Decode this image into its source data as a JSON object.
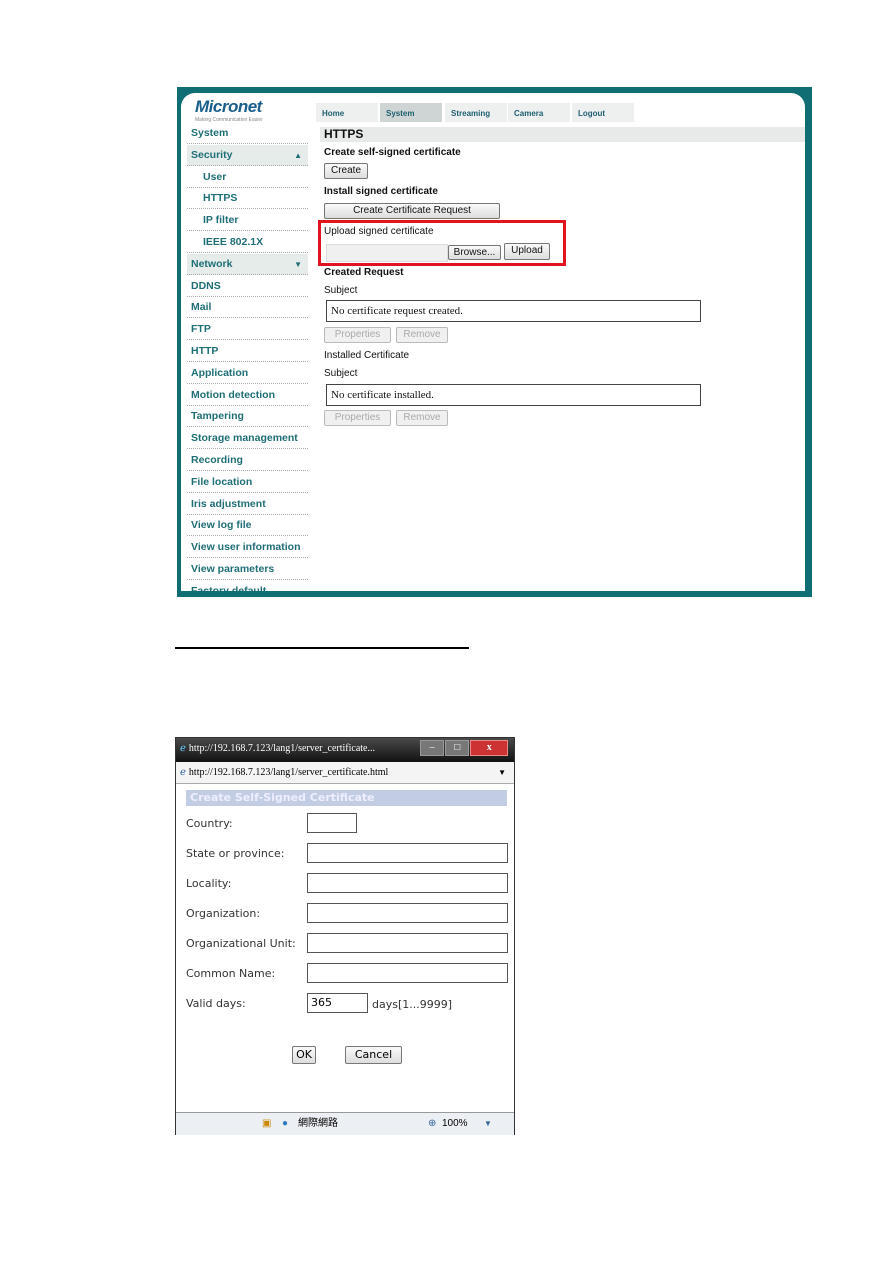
{
  "app": {
    "logo": "Micronet",
    "logo_tagline": "Making Communication Easier",
    "tabs": [
      "Home",
      "System",
      "Streaming",
      "Camera",
      "Logout"
    ],
    "active_tab": "System",
    "sidebar": [
      {
        "label": "System",
        "type": "item"
      },
      {
        "label": "Security",
        "type": "group",
        "arrow": "▲"
      },
      {
        "label": "User",
        "type": "sub"
      },
      {
        "label": "HTTPS",
        "type": "sub"
      },
      {
        "label": "IP filter",
        "type": "sub"
      },
      {
        "label": "IEEE 802.1X",
        "type": "sub"
      },
      {
        "label": "Network",
        "type": "group",
        "arrow": "▼"
      },
      {
        "label": "DDNS",
        "type": "item"
      },
      {
        "label": "Mail",
        "type": "item"
      },
      {
        "label": "FTP",
        "type": "item"
      },
      {
        "label": "HTTP",
        "type": "item"
      },
      {
        "label": "Application",
        "type": "item"
      },
      {
        "label": "Motion detection",
        "type": "item"
      },
      {
        "label": "Tampering",
        "type": "item"
      },
      {
        "label": "Storage management",
        "type": "item"
      },
      {
        "label": "Recording",
        "type": "item"
      },
      {
        "label": "File location",
        "type": "item"
      },
      {
        "label": "Iris adjustment",
        "type": "item"
      },
      {
        "label": "View log file",
        "type": "item"
      },
      {
        "label": "View user information",
        "type": "item"
      },
      {
        "label": "View parameters",
        "type": "item"
      },
      {
        "label": "Factory default",
        "type": "item"
      }
    ],
    "page_title": "HTTPS",
    "create_heading": "Create self-signed certificate",
    "create_btn": "Create",
    "install_heading": "Install signed certificate",
    "request_btn": "Create Certificate Request",
    "upload_label": "Upload signed certificate",
    "browse_btn": "Browse...",
    "upload_btn": "Upload",
    "created_request": "Created Request",
    "subject1": "Subject",
    "request_box": "No certificate request created.",
    "properties": "Properties",
    "remove": "Remove",
    "installed_cert": "Installed Certificate",
    "subject2": "Subject",
    "installed_box": "No certificate installed.",
    "highlight_color": "#e0141e"
  },
  "popup": {
    "title": "http://192.168.7.123/lang1/server_certificate...",
    "address": "http://192.168.7.123/lang1/server_certificate.html",
    "heading": "Create Self-Signed Certificate",
    "fields": [
      {
        "label": "Country:",
        "value": ""
      },
      {
        "label": "State or province:",
        "value": ""
      },
      {
        "label": "Locality:",
        "value": ""
      },
      {
        "label": "Organization:",
        "value": ""
      },
      {
        "label": "Organizational Unit:",
        "value": ""
      },
      {
        "label": "Common Name:",
        "value": ""
      },
      {
        "label": "Valid days:",
        "value": "365"
      }
    ],
    "valid_hint": "days[1...9999]",
    "ok": "OK",
    "cancel": "Cancel",
    "status_zone": "網際網路",
    "zoom": "100%"
  }
}
